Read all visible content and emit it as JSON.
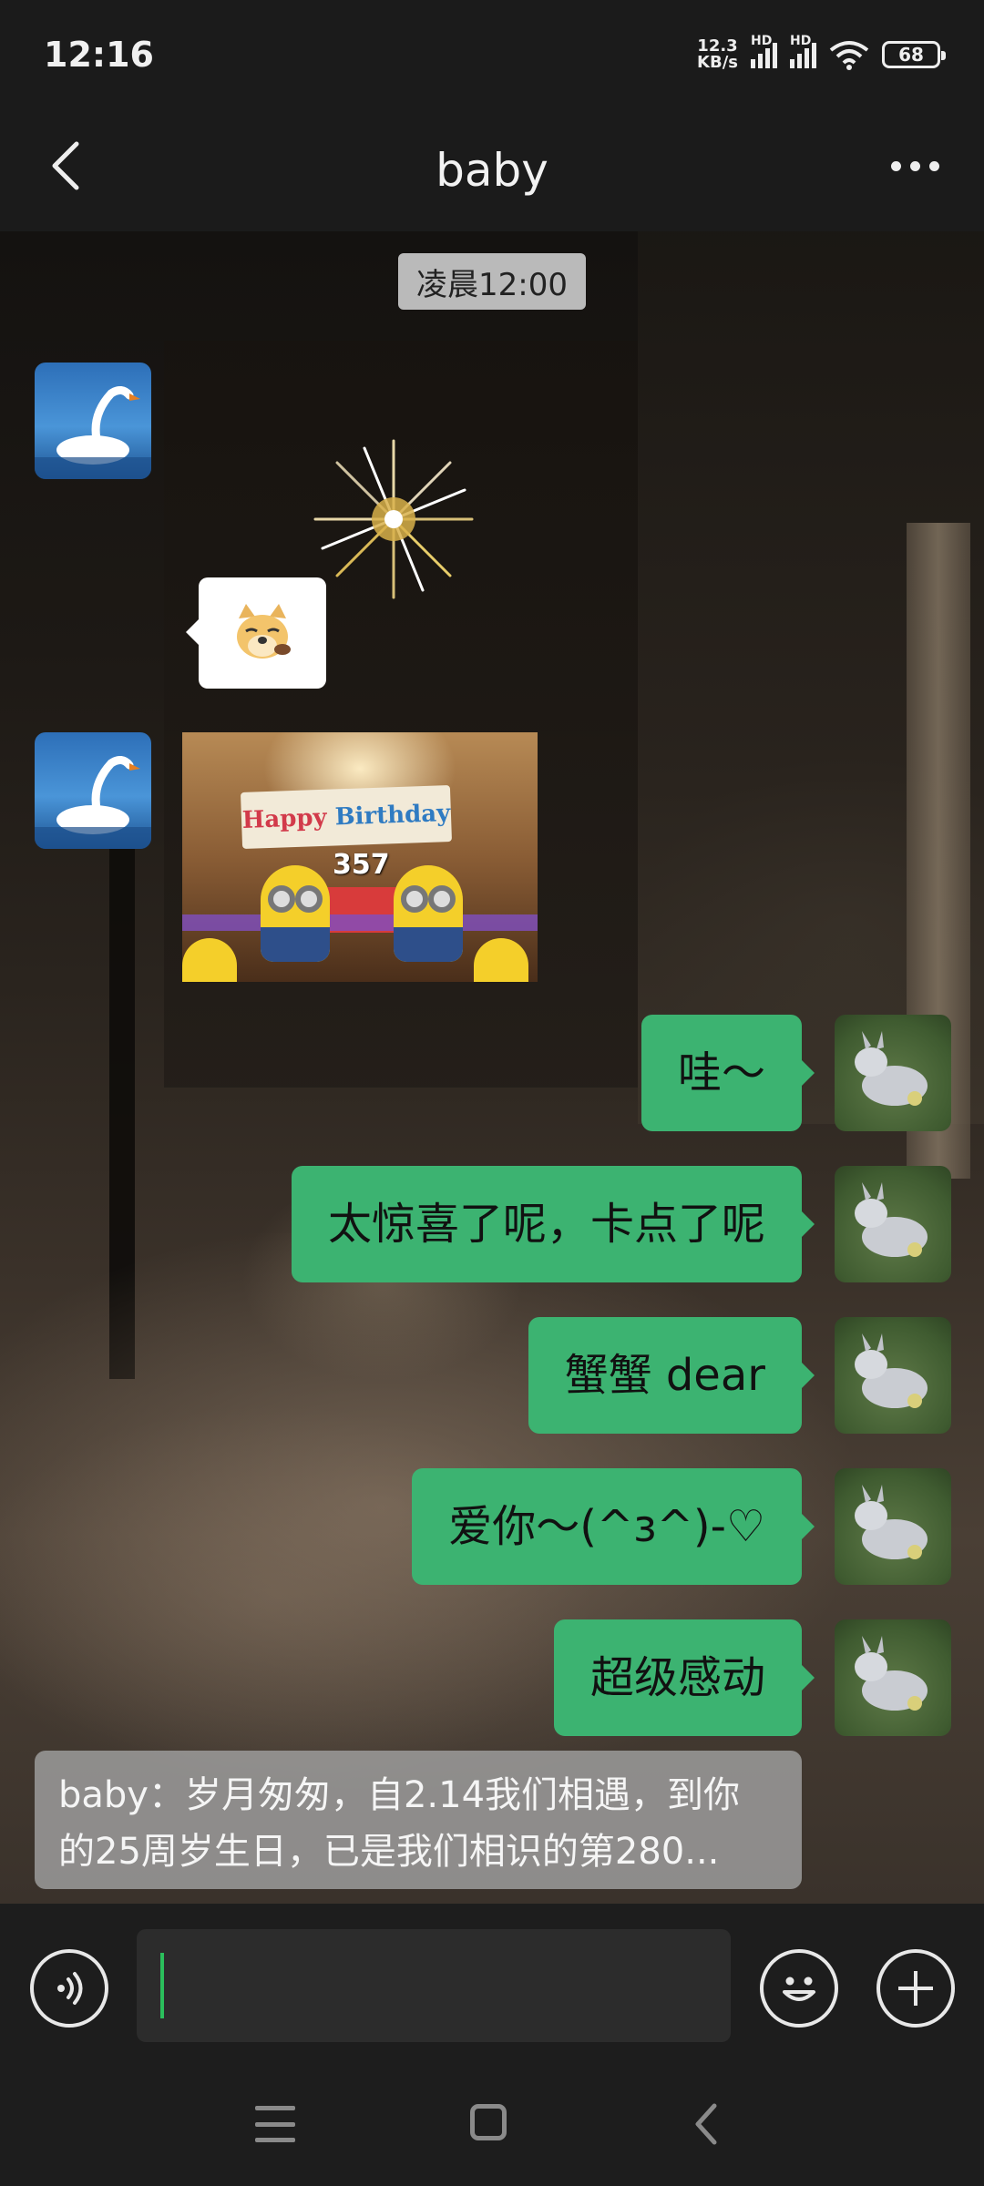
{
  "status_bar": {
    "time": "12:16",
    "net_speed_top": "12.3",
    "net_speed_bottom": "KB/s",
    "hd_label": "HD",
    "battery": "68"
  },
  "header": {
    "title": "baby",
    "back_icon": "chevron-left-icon",
    "more_icon": "more-horizontal-icon"
  },
  "chat": {
    "timestamp": "凌晨12:00",
    "incoming": [
      {
        "type": "sticker",
        "icon": "firework-sticker"
      },
      {
        "type": "sticker",
        "icon": "doge-emoji"
      },
      {
        "type": "image",
        "banner_words": [
          "Happy",
          "Birthday"
        ],
        "number": "357"
      }
    ],
    "outgoing": [
      {
        "text": "哇～"
      },
      {
        "text": "太惊喜了呢，卡点了呢"
      },
      {
        "text": "蟹蟹 dear"
      },
      {
        "text": "爱你～(^з^)-♡"
      },
      {
        "text": "超级感动"
      }
    ],
    "preview": {
      "line1": "baby：岁月匆匆，自2.14我们相遇，到你",
      "line2": "的25周岁生日，已是我们相识的第280..."
    }
  },
  "input_bar": {
    "value": "",
    "voice_icon": "voice-icon",
    "emoji_icon": "emoji-icon",
    "plus_icon": "plus-icon",
    "cursor_color": "#2bbf5c"
  },
  "nav_bar": {
    "menu_icon": "menu-icon",
    "home_icon": "home-icon",
    "back_icon": "back-icon"
  },
  "colors": {
    "bubble_me": "#3cb371",
    "bar_bg": "#1d1d1d"
  }
}
